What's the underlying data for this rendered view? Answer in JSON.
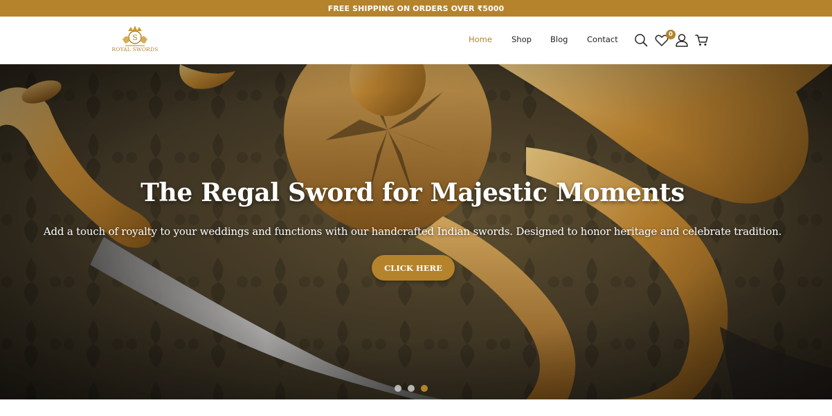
{
  "announcement": "FREE SHIPPING ON ORDERS OVER ₹5000",
  "logo": {
    "text": "ROYAL SWORDS",
    "monogram": "S"
  },
  "nav": {
    "items": [
      {
        "label": "Home",
        "active": true
      },
      {
        "label": "Shop",
        "active": false
      },
      {
        "label": "Blog",
        "active": false
      },
      {
        "label": "Contact",
        "active": false
      }
    ]
  },
  "icons": {
    "search": "search-icon",
    "wishlist": "heart-icon",
    "account": "user-icon",
    "cart": "cart-icon"
  },
  "wishlist_count": "0",
  "hero": {
    "title": "The Regal Sword for Majestic Moments",
    "subtitle": "Add a touch of royalty to your weddings and functions with our handcrafted Indian swords. Designed to honor heritage and celebrate tradition.",
    "button_label": "CLICK HERE"
  },
  "slider": {
    "count": 3,
    "active_index": 2
  },
  "colors": {
    "accent": "#b5832b",
    "text": "#222222",
    "white": "#ffffff"
  }
}
